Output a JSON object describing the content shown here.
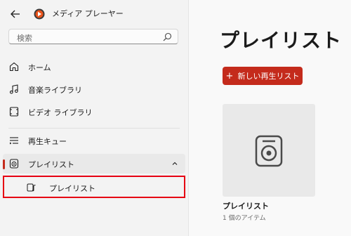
{
  "app": {
    "title": "メディア プレーヤー"
  },
  "search": {
    "placeholder": "検索"
  },
  "nav": {
    "home": "ホーム",
    "music": "音楽ライブラリ",
    "video": "ビデオ ライブラリ",
    "queue": "再生キュー",
    "playlists": "プレイリスト",
    "sub_playlist": "プレイリスト"
  },
  "main": {
    "title": "プレイリスト",
    "new_button": "新しい再生リスト",
    "new_button_icon": "+",
    "tile_title": "プレイリスト",
    "tile_subtitle": "1 個のアイテム"
  },
  "colors": {
    "accent": "#c42b1c",
    "highlight": "#e60012"
  }
}
